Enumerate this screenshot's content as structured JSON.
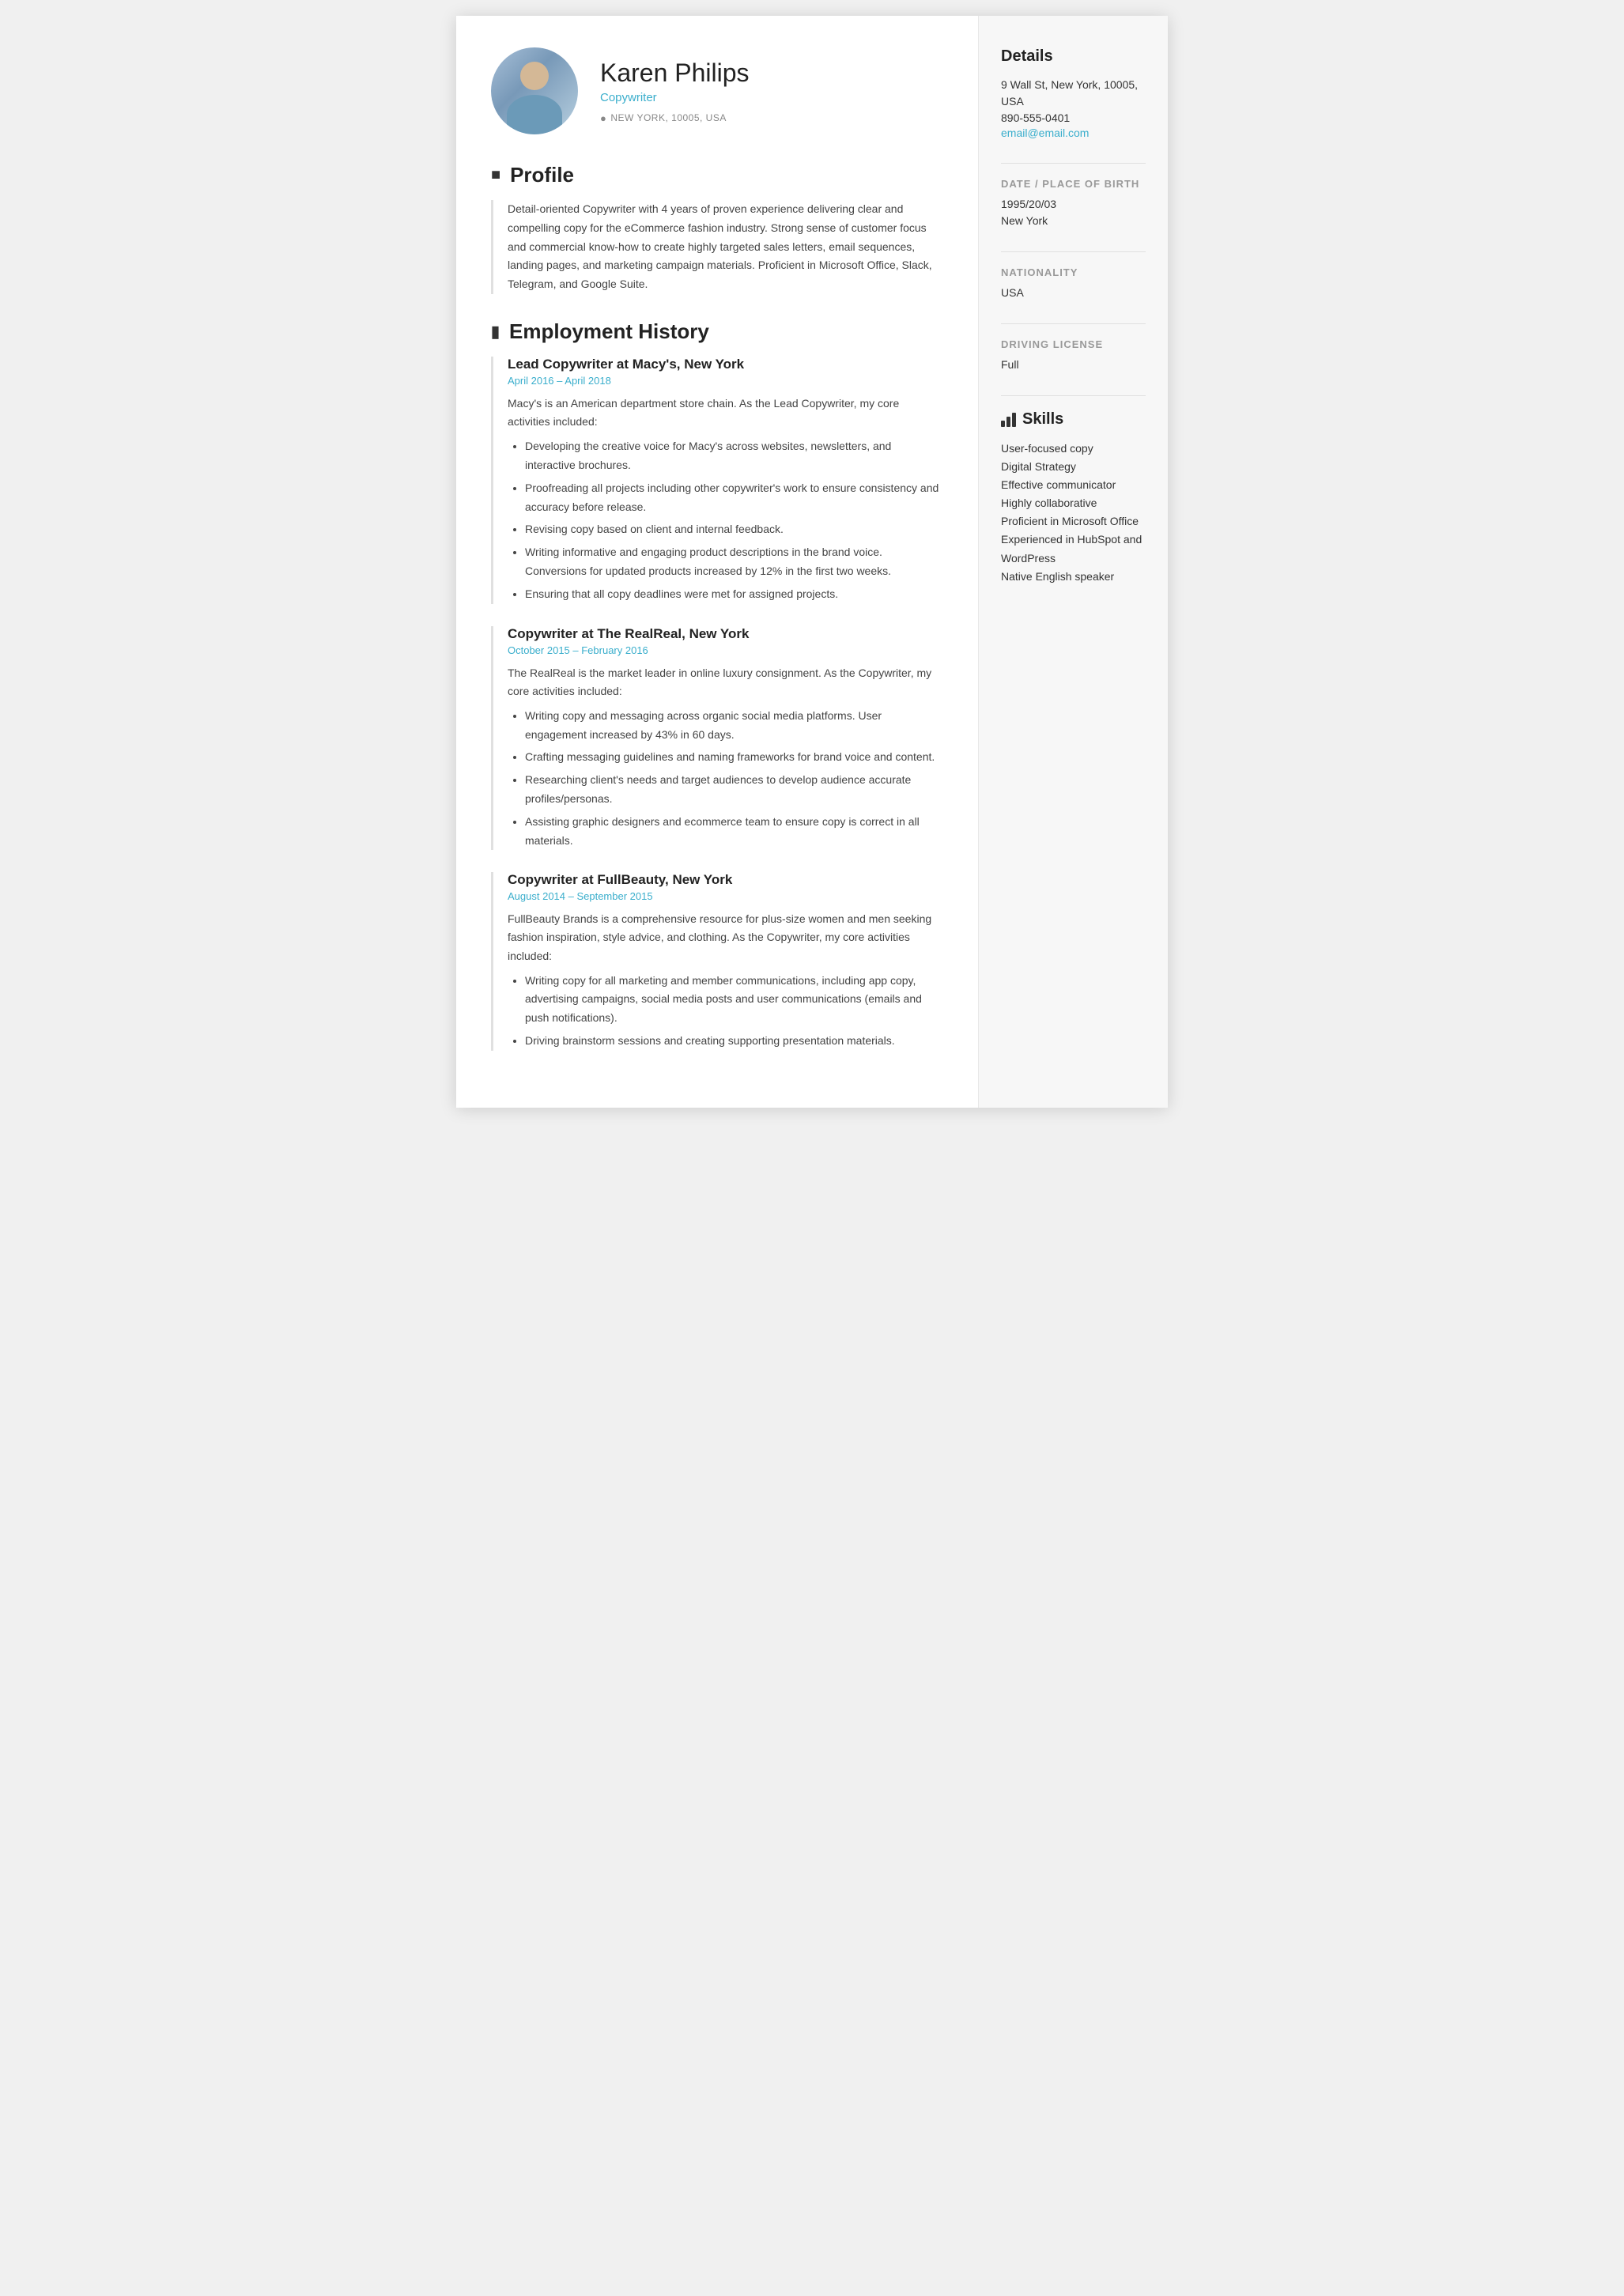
{
  "header": {
    "name": "Karen Philips",
    "title": "Copywriter",
    "location": "NEW YORK, 10005, USA"
  },
  "sections": {
    "profile": {
      "label": "Profile",
      "icon": "person-icon",
      "text": "Detail-oriented Copywriter with 4 years of proven experience delivering clear and compelling copy for the eCommerce fashion industry. Strong sense of customer focus and commercial know-how to create highly targeted sales letters, email sequences, landing pages, and marketing campaign materials. Proficient in Microsoft Office, Slack, Telegram, and Google Suite."
    },
    "employment": {
      "label": "Employment History",
      "icon": "briefcase-icon",
      "jobs": [
        {
          "title": "Lead Copywriter at Macy's, New York",
          "dates": "April 2016  –  April 2018",
          "description": "Macy's is an American department store chain. As the Lead Copywriter, my core activities included:",
          "bullets": [
            "Developing the creative voice for Macy's across websites, newsletters, and interactive brochures.",
            "Proofreading all projects including other copywriter's work to ensure consistency and accuracy before release.",
            "Revising copy based on client and internal feedback.",
            "Writing informative and engaging product descriptions in the brand voice. Conversions for updated products increased by 12% in the first two weeks.",
            "Ensuring that all copy deadlines were met for assigned projects."
          ]
        },
        {
          "title": "Copywriter at The RealReal, New York",
          "dates": "October 2015  –  February 2016",
          "description": "The RealReal is the market leader in online luxury consignment. As the Copywriter, my core activities included:",
          "bullets": [
            "Writing copy and messaging across organic social media platforms. User engagement increased by 43% in 60 days.",
            "Crafting messaging guidelines and naming frameworks for brand voice and content.",
            "Researching client's needs and target audiences to develop audience accurate profiles/personas.",
            "Assisting graphic designers and ecommerce team to ensure copy is correct in all materials."
          ]
        },
        {
          "title": "Copywriter at FullBeauty, New York",
          "dates": "August 2014  –  September 2015",
          "description": "FullBeauty Brands is a comprehensive resource for plus-size women and men seeking fashion inspiration, style advice, and clothing. As the Copywriter, my core activities included:",
          "bullets": [
            "Writing copy for all marketing and member communications, including app copy, advertising campaigns, social media posts and user communications (emails and push notifications).",
            "Driving brainstorm sessions and creating supporting presentation materials."
          ]
        }
      ]
    }
  },
  "sidebar": {
    "details_title": "Details",
    "address": "9 Wall St, New York, 10005, USA",
    "phone": "890-555-0401",
    "email": "email@email.com",
    "dob_label": "DATE / PLACE OF BIRTH",
    "dob": "1995/20/03",
    "place": "New York",
    "nationality_label": "NATIONALITY",
    "nationality": "USA",
    "license_label": "DRIVING LICENSE",
    "license": "Full",
    "skills_title": "Skills",
    "skills": [
      "User-focused copy",
      "Digital Strategy",
      "Effective communicator",
      "Highly collaborative",
      "Proficient in Microsoft Office",
      "Experienced in HubSpot and WordPress",
      "Native English speaker"
    ]
  }
}
